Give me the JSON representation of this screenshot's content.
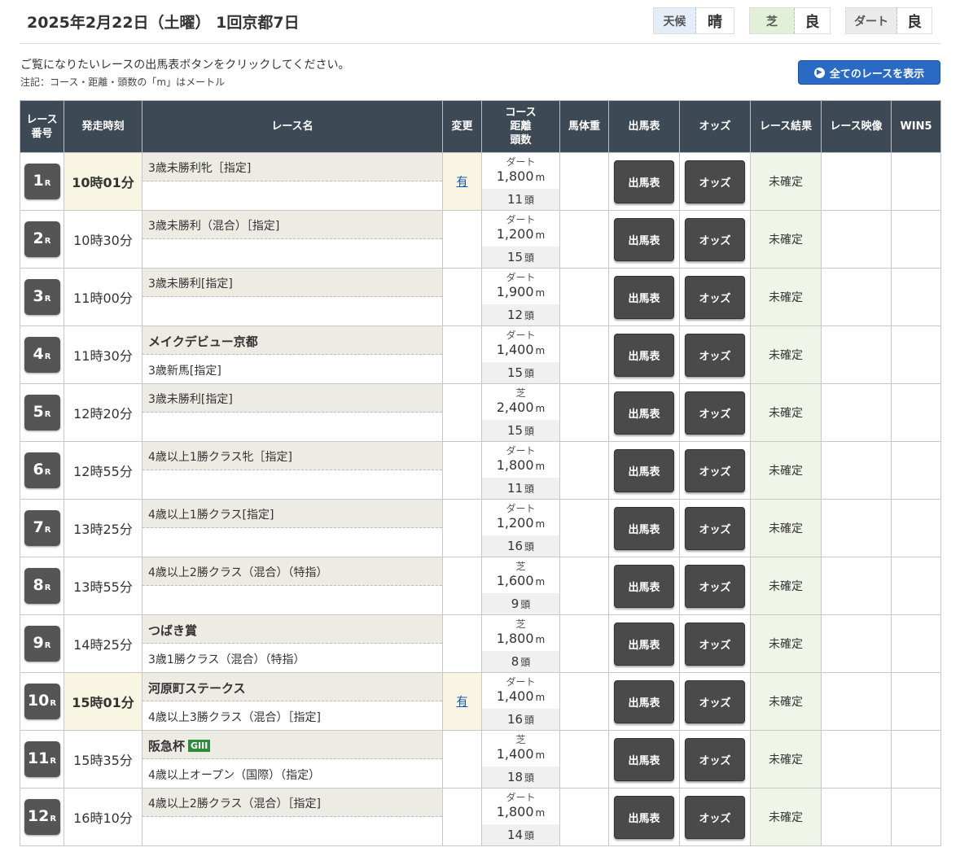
{
  "header": {
    "title": "2025年2月22日（土曜） 1回京都7日",
    "conditions": [
      {
        "label": "天候",
        "value": "晴",
        "color": "#e4eef8"
      },
      {
        "label": "芝",
        "value": "良",
        "color": "#e3f0d8"
      },
      {
        "label": "ダート",
        "value": "良",
        "color": "#ebebeb"
      }
    ]
  },
  "intro": "ご覧になりたいレースの出馬表ボタンをクリックしてください。",
  "note": "注記：コース・距離・頭数の「m」はメートル",
  "all_races_button": {
    "label": "全てのレースを表示",
    "icon": "circle-arrow-right-icon",
    "color": "#2a69c4"
  },
  "table": {
    "headers": {
      "race_no": [
        "レース",
        "番号"
      ],
      "time": "発走時刻",
      "name": "レース名",
      "change": "変更",
      "course": [
        "コース",
        "距離",
        "頭数"
      ],
      "weight": "馬体重",
      "card": "出馬表",
      "odds": "オッズ",
      "result": "レース結果",
      "video": "レース映像",
      "win5": "WIN5"
    },
    "rows": [
      {
        "num": "1",
        "r": "R",
        "time": "10時01分",
        "highlight": true,
        "title": "",
        "grade": "",
        "cond_top": "3歳未勝利牝［指定]",
        "cond_bottom": "",
        "change": "有",
        "surface": "ダート",
        "distance": "1,800",
        "dist_unit": "m",
        "heads": "11",
        "heads_unit": "頭",
        "card": "出馬表",
        "odds": "オッズ",
        "result": "未確定"
      },
      {
        "num": "2",
        "r": "R",
        "time": "10時30分",
        "highlight": false,
        "title": "",
        "grade": "",
        "cond_top": "3歳未勝利（混合）［指定]",
        "cond_bottom": "",
        "change": "",
        "surface": "ダート",
        "distance": "1,200",
        "dist_unit": "m",
        "heads": "15",
        "heads_unit": "頭",
        "card": "出馬表",
        "odds": "オッズ",
        "result": "未確定"
      },
      {
        "num": "3",
        "r": "R",
        "time": "11時00分",
        "highlight": false,
        "title": "",
        "grade": "",
        "cond_top": "3歳未勝利[指定]",
        "cond_bottom": "",
        "change": "",
        "surface": "ダート",
        "distance": "1,900",
        "dist_unit": "m",
        "heads": "12",
        "heads_unit": "頭",
        "card": "出馬表",
        "odds": "オッズ",
        "result": "未確定"
      },
      {
        "num": "4",
        "r": "R",
        "time": "11時30分",
        "highlight": false,
        "title": "メイクデビュー京都",
        "grade": "",
        "cond_top": "",
        "cond_bottom": "3歳新馬[指定]",
        "change": "",
        "surface": "ダート",
        "distance": "1,400",
        "dist_unit": "m",
        "heads": "15",
        "heads_unit": "頭",
        "card": "出馬表",
        "odds": "オッズ",
        "result": "未確定"
      },
      {
        "num": "5",
        "r": "R",
        "time": "12時20分",
        "highlight": false,
        "title": "",
        "grade": "",
        "cond_top": "3歳未勝利[指定]",
        "cond_bottom": "",
        "change": "",
        "surface": "芝",
        "distance": "2,400",
        "dist_unit": "m",
        "heads": "15",
        "heads_unit": "頭",
        "card": "出馬表",
        "odds": "オッズ",
        "result": "未確定"
      },
      {
        "num": "6",
        "r": "R",
        "time": "12時55分",
        "highlight": false,
        "title": "",
        "grade": "",
        "cond_top": "4歳以上1勝クラス牝［指定]",
        "cond_bottom": "",
        "change": "",
        "surface": "ダート",
        "distance": "1,800",
        "dist_unit": "m",
        "heads": "11",
        "heads_unit": "頭",
        "card": "出馬表",
        "odds": "オッズ",
        "result": "未確定"
      },
      {
        "num": "7",
        "r": "R",
        "time": "13時25分",
        "highlight": false,
        "title": "",
        "grade": "",
        "cond_top": "4歳以上1勝クラス[指定]",
        "cond_bottom": "",
        "change": "",
        "surface": "ダート",
        "distance": "1,200",
        "dist_unit": "m",
        "heads": "16",
        "heads_unit": "頭",
        "card": "出馬表",
        "odds": "オッズ",
        "result": "未確定"
      },
      {
        "num": "8",
        "r": "R",
        "time": "13時55分",
        "highlight": false,
        "title": "",
        "grade": "",
        "cond_top": "4歳以上2勝クラス（混合）（特指）",
        "cond_bottom": "",
        "change": "",
        "surface": "芝",
        "distance": "1,600",
        "dist_unit": "m",
        "heads": "9",
        "heads_unit": "頭",
        "card": "出馬表",
        "odds": "オッズ",
        "result": "未確定"
      },
      {
        "num": "9",
        "r": "R",
        "time": "14時25分",
        "highlight": false,
        "title": "つばき賞",
        "grade": "",
        "cond_top": "",
        "cond_bottom": "3歳1勝クラス（混合）（特指）",
        "change": "",
        "surface": "芝",
        "distance": "1,800",
        "dist_unit": "m",
        "heads": "8",
        "heads_unit": "頭",
        "card": "出馬表",
        "odds": "オッズ",
        "result": "未確定"
      },
      {
        "num": "10",
        "r": "R",
        "time": "15時01分",
        "highlight": true,
        "title": "河原町ステークス",
        "grade": "",
        "cond_top": "",
        "cond_bottom": "4歳以上3勝クラス（混合）［指定]",
        "change": "有",
        "surface": "ダート",
        "distance": "1,400",
        "dist_unit": "m",
        "heads": "16",
        "heads_unit": "頭",
        "card": "出馬表",
        "odds": "オッズ",
        "result": "未確定"
      },
      {
        "num": "11",
        "r": "R",
        "time": "15時35分",
        "highlight": false,
        "title": "阪急杯",
        "grade": "GIII",
        "cond_top": "",
        "cond_bottom": "4歳以上オープン（国際）（指定）",
        "change": "",
        "surface": "芝",
        "distance": "1,400",
        "dist_unit": "m",
        "heads": "18",
        "heads_unit": "頭",
        "card": "出馬表",
        "odds": "オッズ",
        "result": "未確定"
      },
      {
        "num": "12",
        "r": "R",
        "time": "16時10分",
        "highlight": false,
        "title": "",
        "grade": "",
        "cond_top": "4歳以上2勝クラス（混合）［指定]",
        "cond_bottom": "",
        "change": "",
        "surface": "ダート",
        "distance": "1,800",
        "dist_unit": "m",
        "heads": "14",
        "heads_unit": "頭",
        "card": "出馬表",
        "odds": "オッズ",
        "result": "未確定"
      }
    ]
  }
}
